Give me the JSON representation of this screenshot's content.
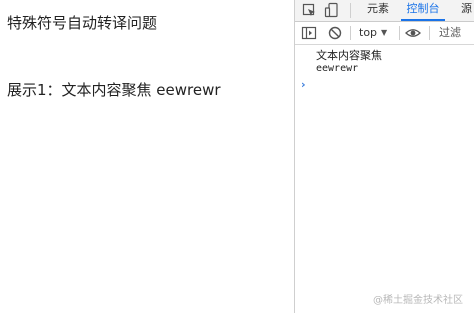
{
  "page": {
    "title": "特殊符号自动转译问题",
    "demo_line": "展示1：文本内容聚焦 eewrewr"
  },
  "devtools": {
    "tabs": [
      {
        "label": "元素",
        "active": false
      },
      {
        "label": "控制台",
        "active": true
      },
      {
        "label": "源",
        "active": false
      }
    ],
    "toolbar": {
      "context": "top",
      "filter_placeholder": "过滤"
    },
    "console": {
      "lines": [
        "文本内容聚焦",
        "eewrewr"
      ],
      "prompt_symbol": "›"
    },
    "watermark": "@稀土掘金技术社区"
  },
  "colors": {
    "accent": "#1a73e8",
    "tabbar_bg": "#f3f3f3",
    "border": "#cbcbcb"
  },
  "icons": [
    "inspect-icon",
    "device-toggle-icon",
    "sidebar-toggle-icon",
    "clear-console-icon",
    "eye-icon"
  ]
}
